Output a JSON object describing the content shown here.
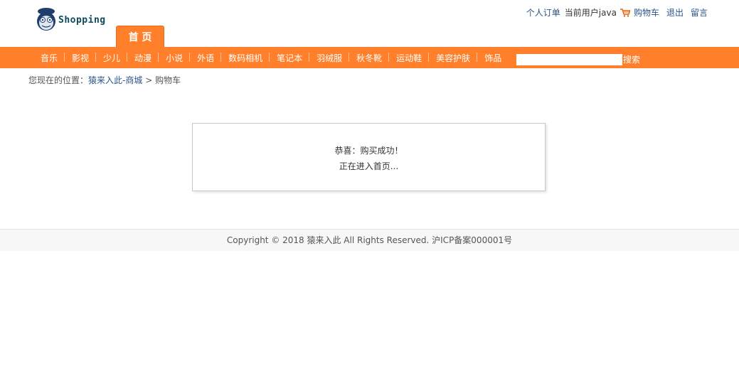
{
  "brand": {
    "logo_text": "Shopping"
  },
  "header": {
    "home_tab": "首 页",
    "links": {
      "orders": "个人订单",
      "current_user": "当前用户java",
      "cart": "购物车",
      "logout": "退出",
      "message": "留言"
    }
  },
  "nav": {
    "items": [
      "音乐",
      "影视",
      "少儿",
      "动漫",
      "小说",
      "外语",
      "数码相机",
      "笔记本",
      "羽绒服",
      "秋冬靴",
      "运动鞋",
      "美容护肤",
      "饰品"
    ],
    "search_button": "搜索",
    "search_value": ""
  },
  "breadcrumb": {
    "prefix": "您现在的位置：",
    "link": "猿来入此-商城",
    "separator": ">",
    "current": "购物车"
  },
  "message": {
    "line1": "恭喜：购买成功！",
    "line2": "正在进入首页..."
  },
  "footer": {
    "text": "Copyright © 2018 猿来入此 All Rights Reserved. 沪ICP备案000001号"
  },
  "colors": {
    "accent": "#ff7f2a",
    "link": "#2b5488"
  }
}
